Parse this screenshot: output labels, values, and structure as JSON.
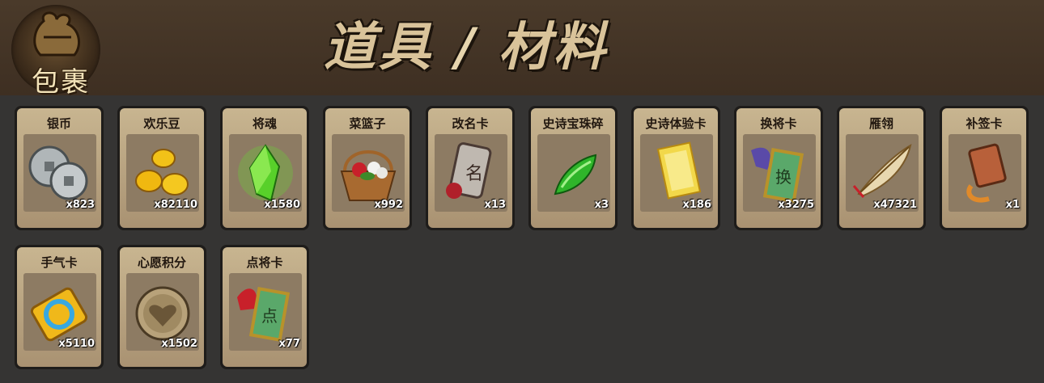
{
  "header": {
    "badge_label": "包裹",
    "title_left": "道具",
    "title_sep": "/",
    "title_right": "材料"
  },
  "items": [
    {
      "name": "银币",
      "count": "x823",
      "icon": "silver-coins-icon"
    },
    {
      "name": "欢乐豆",
      "count": "x82110",
      "icon": "gold-beans-icon"
    },
    {
      "name": "将魂",
      "count": "x1580",
      "icon": "green-crystal-icon"
    },
    {
      "name": "菜篮子",
      "count": "x992",
      "icon": "flower-basket-icon"
    },
    {
      "name": "改名卡",
      "count": "x13",
      "icon": "rename-card-icon"
    },
    {
      "name": "史诗宝珠碎",
      "count": "x3",
      "icon": "green-shard-icon"
    },
    {
      "name": "史诗体验卡",
      "count": "x186",
      "icon": "gold-card-icon"
    },
    {
      "name": "换将卡",
      "count": "x3275",
      "icon": "swap-general-card-icon"
    },
    {
      "name": "雁翎",
      "count": "x47321",
      "icon": "feather-icon"
    },
    {
      "name": "补签卡",
      "count": "x1",
      "icon": "makeup-sign-card-icon"
    },
    {
      "name": "手气卡",
      "count": "x5110",
      "icon": "luck-card-icon"
    },
    {
      "name": "心愿积分",
      "count": "x1502",
      "icon": "heart-coin-icon"
    },
    {
      "name": "点将卡",
      "count": "x77",
      "icon": "pick-general-card-icon"
    }
  ]
}
